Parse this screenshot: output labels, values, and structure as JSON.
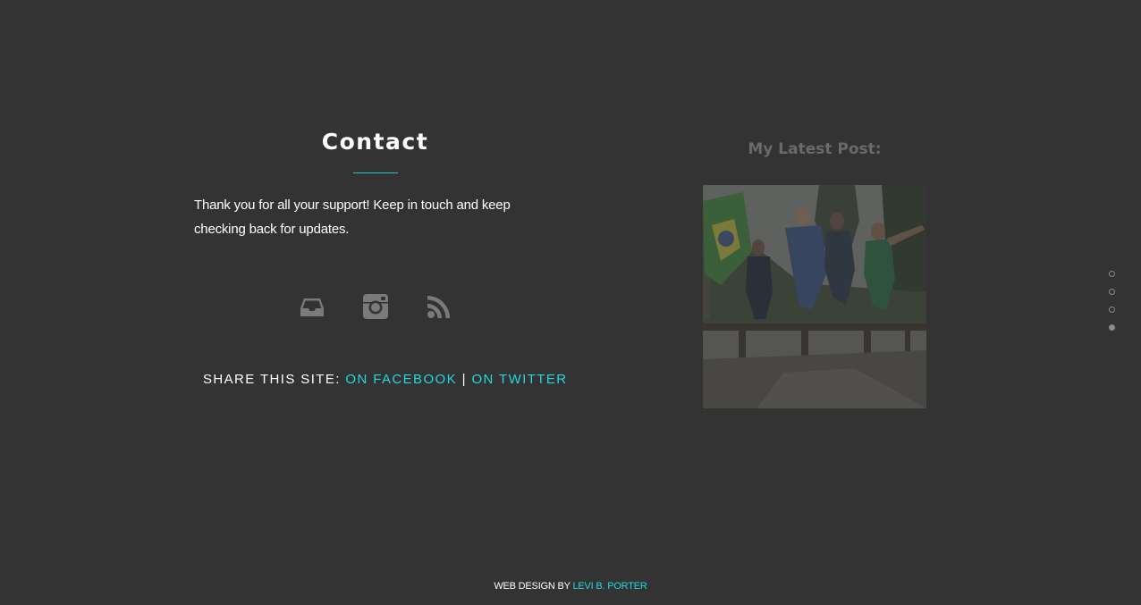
{
  "contact": {
    "title": "Contact",
    "text": "Thank you for all your support! Keep in touch and keep checking back for updates.",
    "icons": [
      "inbox-icon",
      "instagram-icon",
      "rss-icon"
    ],
    "share_prefix": "SHARE THIS SITE:",
    "share_facebook": "ON FACEBOOK",
    "share_separator": "|",
    "share_twitter": "ON TWITTER"
  },
  "latest_post": {
    "title": "My Latest Post:"
  },
  "section_nav": {
    "active_index": 3,
    "count": 4
  },
  "footer": {
    "prefix": "WEB DESIGN BY",
    "author": "LEVI B. PORTER"
  },
  "colors": {
    "background": "#333333",
    "accent": "#21d8e0",
    "muted": "#6a6a6a"
  }
}
